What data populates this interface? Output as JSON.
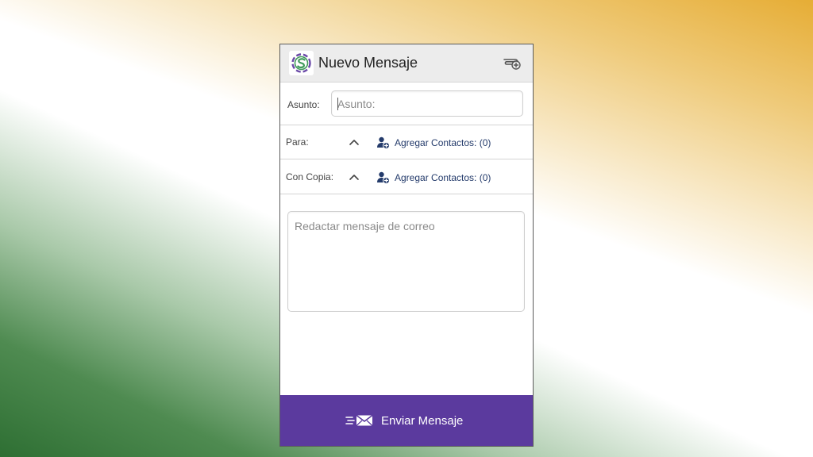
{
  "colors": {
    "accent_purple": "#5b3a9e",
    "link_blue": "#243b6b",
    "appbar_bg": "#ececec",
    "bg_orange": "#e6ad35",
    "bg_green": "#2e6f33"
  },
  "appbar": {
    "title": "Nuevo Mensaje",
    "logo_icon": "app-logo-s-icon",
    "attach_icon": "paperclip-add-icon"
  },
  "subject": {
    "label": "Asunto:",
    "placeholder": "Asunto:",
    "value": ""
  },
  "to": {
    "label": "Para:",
    "toggle_icon": "chevron-up-icon",
    "add_icon": "add-contact-icon",
    "add_label": "Agregar Contactos: (0)"
  },
  "cc": {
    "label": "Con Copia:",
    "toggle_icon": "chevron-up-icon",
    "add_icon": "add-contact-icon",
    "add_label": "Agregar Contactos: (0)"
  },
  "message": {
    "placeholder": "Redactar mensaje de correo",
    "value": ""
  },
  "send": {
    "icon": "send-envelope-icon",
    "label": "Enviar Mensaje"
  }
}
